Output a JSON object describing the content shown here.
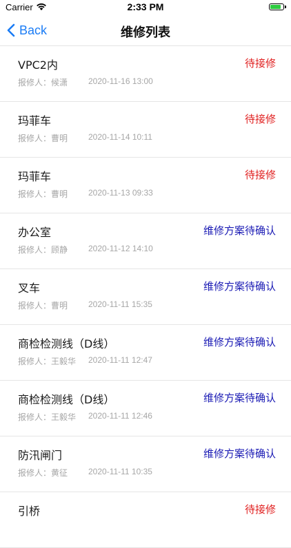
{
  "status_bar": {
    "carrier": "Carrier",
    "time": "2:33 PM",
    "battery_level": 0.85
  },
  "nav": {
    "back_label": "Back",
    "title": "维修列表"
  },
  "colors": {
    "pending": "#e02020",
    "awaiting_confirmation": "#1a1ab4",
    "back": "#1a7cf5"
  },
  "items": [
    {
      "name": "VPC2内",
      "status": "待接修",
      "status_type": "pending",
      "reporter": "报修人：候潇",
      "time": "2020-11-16 13:00"
    },
    {
      "name": "玛菲车",
      "status": "待接修",
      "status_type": "pending",
      "reporter": "报修人：曹明",
      "time": "2020-11-14 10:11"
    },
    {
      "name": "玛菲车",
      "status": "待接修",
      "status_type": "pending",
      "reporter": "报修人：曹明",
      "time": "2020-11-13 09:33"
    },
    {
      "name": "办公室",
      "status": "维修方案待确认",
      "status_type": "awaiting_confirmation",
      "reporter": "报修人：顾静",
      "time": "2020-11-12 14:10"
    },
    {
      "name": "叉车",
      "status": "维修方案待确认",
      "status_type": "awaiting_confirmation",
      "reporter": "报修人：曹明",
      "time": "2020-11-11 15:35"
    },
    {
      "name": "商检检测线（D线）",
      "status": "维修方案待确认",
      "status_type": "awaiting_confirmation",
      "reporter": "报修人：王毅华",
      "time": "2020-11-11 12:47"
    },
    {
      "name": "商检检测线（D线）",
      "status": "维修方案待确认",
      "status_type": "awaiting_confirmation",
      "reporter": "报修人：王毅华",
      "time": "2020-11-11 12:46"
    },
    {
      "name": "防汛闸门",
      "status": "维修方案待确认",
      "status_type": "awaiting_confirmation",
      "reporter": "报修人：黄征",
      "time": "2020-11-11 10:35"
    },
    {
      "name": "引桥",
      "status": "待接修",
      "status_type": "pending",
      "reporter": "",
      "time": ""
    }
  ]
}
